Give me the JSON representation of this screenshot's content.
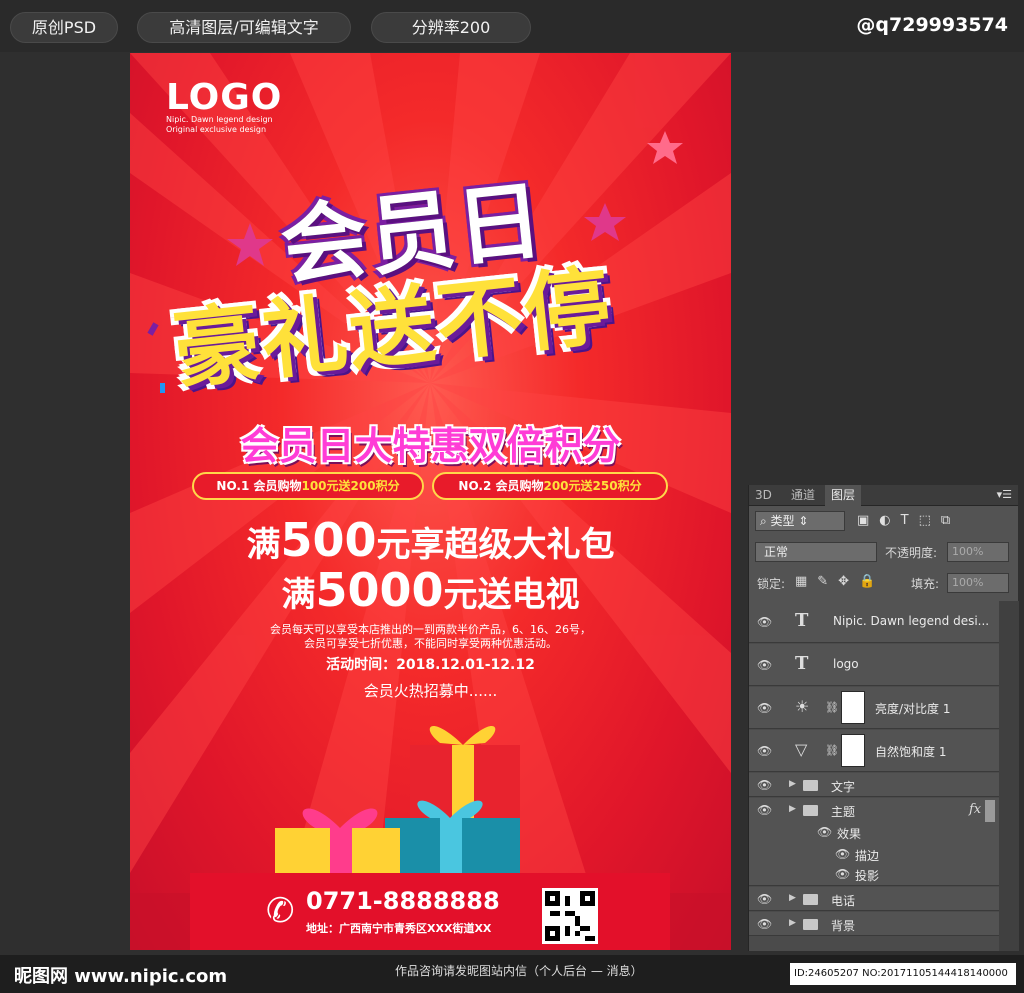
{
  "topbar": {
    "tag1": "原创PSD",
    "tag2": "高清图层/可编辑文字",
    "tag3": "分辨率200",
    "handle": "@q729993574"
  },
  "poster": {
    "logo": "LOGO",
    "logo_sub1": "Nipic. Dawn legend design",
    "logo_sub2": "Original exclusive design",
    "title1": "会员日",
    "title2": "豪礼送不停",
    "subtitle": "会员日大特惠双倍积分",
    "badge1_prefix": "NO.1 会员购物",
    "badge1_hl": "100元送200积分",
    "badge2_prefix": "NO.2 会员购物",
    "badge2_hl": "200元送250积分",
    "offer1_pre": "满",
    "offer1_num": "500",
    "offer1_post": "元享超级大礼包",
    "offer2_pre": "满",
    "offer2_num": "5000",
    "offer2_post": "元送电视",
    "desc1": "会员每天可以享受本店推出的一到两款半价产品，6、16、26号，",
    "desc2": "会员可享受七折优惠，不能同时享受两种优惠活动。",
    "event": "活动时间：2018.12.01-12.12",
    "recruit": "会员火热招募中......",
    "phone": "0771-8888888",
    "address": "地址：广西南宁市青秀区XXX街道XX",
    "colors": {
      "bg": "#f42a2a",
      "accent_yellow": "#ffe13a",
      "accent_pink": "#ff3cd6"
    }
  },
  "panel": {
    "tabs": [
      "3D",
      "通道",
      "图层"
    ],
    "active_tab": "图层",
    "filter_label": "类型",
    "blend_mode": "正常",
    "opacity_label": "不透明度:",
    "opacity_value": "100%",
    "lock_label": "锁定:",
    "fill_label": "填充:",
    "fill_value": "100%",
    "layers": [
      {
        "name": "Nipic. Dawn legend desi...",
        "kind": "text",
        "icon": "text-layer-icon"
      },
      {
        "name": "logo",
        "kind": "text",
        "icon": "text-layer-icon"
      },
      {
        "name": "亮度/对比度 1",
        "kind": "adjustment",
        "icon": "brightness-icon"
      },
      {
        "name": "自然饱和度 1",
        "kind": "adjustment",
        "icon": "vibrance-icon"
      },
      {
        "name": "文字",
        "kind": "group",
        "icon": "folder-icon"
      },
      {
        "name": "主题",
        "kind": "group",
        "icon": "folder-icon"
      },
      {
        "name": "效果",
        "kind": "effects",
        "icon": "eye-icon"
      },
      {
        "name": "描边",
        "kind": "effect",
        "icon": "eye-icon"
      },
      {
        "name": "投影",
        "kind": "effect",
        "icon": "eye-icon"
      },
      {
        "name": "电话",
        "kind": "group",
        "icon": "folder-icon"
      },
      {
        "name": "背景",
        "kind": "group",
        "icon": "folder-icon"
      }
    ]
  },
  "bottombar": {
    "brand": "昵图网 www.nipic.com",
    "caption": "作品咨询请发昵图站内信（个人后台 — 消息）",
    "id": "ID:24605207 NO:20171105144418140000"
  }
}
